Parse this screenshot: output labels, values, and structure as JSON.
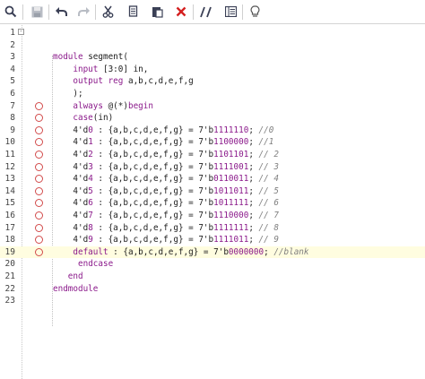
{
  "toolbar": {
    "buttons": [
      {
        "name": "search-icon",
        "glyph": "search"
      },
      {
        "name": "save-icon",
        "glyph": "save"
      },
      {
        "name": "undo-icon",
        "glyph": "undo"
      },
      {
        "name": "redo-icon",
        "glyph": "redo"
      },
      {
        "name": "cut-icon",
        "glyph": "cut"
      },
      {
        "name": "copy-icon",
        "glyph": "copy"
      },
      {
        "name": "paste-icon",
        "glyph": "paste"
      },
      {
        "name": "delete-icon",
        "glyph": "delete"
      },
      {
        "name": "comment-icon",
        "glyph": "comment"
      },
      {
        "name": "indent-icon",
        "glyph": "indent"
      },
      {
        "name": "hint-icon",
        "glyph": "hint"
      }
    ],
    "colors": {
      "icon": "#3a3f55",
      "delete": "#d42020",
      "hint": "#555555"
    }
  },
  "editor": {
    "highlighted_line": 19,
    "colors": {
      "keyword": "#8b1a8b",
      "comment": "#808080",
      "highlight": "#fffde0",
      "breakpoint": "#d24b4b"
    },
    "lines": [
      {
        "n": "1",
        "fold": true,
        "bp": false,
        "tokens": []
      },
      {
        "n": "2",
        "bp": false,
        "tokens": []
      },
      {
        "n": "3",
        "bp": false,
        "tokens": [
          [
            "k",
            "module"
          ],
          [
            "t",
            " segment("
          ]
        ]
      },
      {
        "n": "4",
        "bp": false,
        "tokens": [
          [
            "t",
            "    "
          ],
          [
            "k",
            "input"
          ],
          [
            "t",
            " [3:0] in,"
          ]
        ]
      },
      {
        "n": "5",
        "bp": false,
        "tokens": [
          [
            "t",
            "    "
          ],
          [
            "k",
            "output reg"
          ],
          [
            "t",
            " a,b,c,d,e,f,g"
          ]
        ]
      },
      {
        "n": "6",
        "bp": false,
        "tokens": [
          [
            "t",
            "    );"
          ]
        ]
      },
      {
        "n": "7",
        "bp": true,
        "tokens": [
          [
            "t",
            "    "
          ],
          [
            "k",
            "always"
          ],
          [
            "t",
            " @(*)"
          ],
          [
            "k",
            "begin"
          ]
        ]
      },
      {
        "n": "8",
        "bp": true,
        "tokens": [
          [
            "t",
            "    "
          ],
          [
            "k",
            "case"
          ],
          [
            "t",
            "(in)"
          ]
        ]
      },
      {
        "n": "9",
        "bp": true,
        "tokens": [
          [
            "t",
            "    4'd"
          ],
          [
            "n",
            "0"
          ],
          [
            "t",
            " : {a,b,c,d,e,f,g} = 7'b"
          ],
          [
            "n",
            "1111110"
          ],
          [
            "t",
            "; "
          ],
          [
            "c",
            "//0"
          ]
        ]
      },
      {
        "n": "10",
        "bp": true,
        "tokens": [
          [
            "t",
            "    4'd"
          ],
          [
            "n",
            "1"
          ],
          [
            "t",
            " : {a,b,c,d,e,f,g} = 7'b"
          ],
          [
            "n",
            "1100000"
          ],
          [
            "t",
            "; "
          ],
          [
            "c",
            "//1"
          ]
        ]
      },
      {
        "n": "11",
        "bp": true,
        "tokens": [
          [
            "t",
            "    4'd"
          ],
          [
            "n",
            "2"
          ],
          [
            "t",
            " : {a,b,c,d,e,f,g} = 7'b"
          ],
          [
            "n",
            "1101101"
          ],
          [
            "t",
            "; "
          ],
          [
            "c",
            "// 2"
          ]
        ]
      },
      {
        "n": "12",
        "bp": true,
        "tokens": [
          [
            "t",
            "    4'd"
          ],
          [
            "n",
            "3"
          ],
          [
            "t",
            " : {a,b,c,d,e,f,g} = 7'b"
          ],
          [
            "n",
            "1111001"
          ],
          [
            "t",
            "; "
          ],
          [
            "c",
            "// 3"
          ]
        ]
      },
      {
        "n": "13",
        "bp": true,
        "tokens": [
          [
            "t",
            "    4'd"
          ],
          [
            "n",
            "4"
          ],
          [
            "t",
            " : {a,b,c,d,e,f,g} = 7'b"
          ],
          [
            "n",
            "0110011"
          ],
          [
            "t",
            "; "
          ],
          [
            "c",
            "// 4"
          ]
        ]
      },
      {
        "n": "14",
        "bp": true,
        "tokens": [
          [
            "t",
            "    4'd"
          ],
          [
            "n",
            "5"
          ],
          [
            "t",
            " : {a,b,c,d,e,f,g} = 7'b"
          ],
          [
            "n",
            "1011011"
          ],
          [
            "t",
            "; "
          ],
          [
            "c",
            "// 5"
          ]
        ]
      },
      {
        "n": "15",
        "bp": true,
        "tokens": [
          [
            "t",
            "    4'd"
          ],
          [
            "n",
            "6"
          ],
          [
            "t",
            " : {a,b,c,d,e,f,g} = 7'b"
          ],
          [
            "n",
            "1011111"
          ],
          [
            "t",
            "; "
          ],
          [
            "c",
            "// 6"
          ]
        ]
      },
      {
        "n": "16",
        "bp": true,
        "tokens": [
          [
            "t",
            "    4'd"
          ],
          [
            "n",
            "7"
          ],
          [
            "t",
            " : {a,b,c,d,e,f,g} = 7'b"
          ],
          [
            "n",
            "1110000"
          ],
          [
            "t",
            "; "
          ],
          [
            "c",
            "// 7"
          ]
        ]
      },
      {
        "n": "17",
        "bp": true,
        "tokens": [
          [
            "t",
            "    4'd"
          ],
          [
            "n",
            "8"
          ],
          [
            "t",
            " : {a,b,c,d,e,f,g} = 7'b"
          ],
          [
            "n",
            "1111111"
          ],
          [
            "t",
            "; "
          ],
          [
            "c",
            "// 8"
          ]
        ]
      },
      {
        "n": "18",
        "bp": true,
        "tokens": [
          [
            "t",
            "    4'd"
          ],
          [
            "n",
            "9"
          ],
          [
            "t",
            " : {a,b,c,d,e,f,g} = 7'b"
          ],
          [
            "n",
            "1111011"
          ],
          [
            "t",
            "; "
          ],
          [
            "c",
            "// 9"
          ]
        ]
      },
      {
        "n": "19",
        "bp": true,
        "tokens": [
          [
            "t",
            "    "
          ],
          [
            "k",
            "default"
          ],
          [
            "t",
            " : {a,b,c,d,e,f,g} = 7'b"
          ],
          [
            "n",
            "0000000"
          ],
          [
            "t",
            "; "
          ],
          [
            "c",
            "//blank"
          ]
        ]
      },
      {
        "n": "20",
        "bp": false,
        "tokens": [
          [
            "t",
            "     "
          ],
          [
            "k",
            "endcase"
          ]
        ]
      },
      {
        "n": "21",
        "bp": false,
        "tokens": [
          [
            "t",
            "   "
          ],
          [
            "k",
            "end"
          ]
        ]
      },
      {
        "n": "22",
        "bp": false,
        "tokens": [
          [
            "k",
            "endmodule"
          ]
        ]
      },
      {
        "n": "23",
        "bp": false,
        "tokens": []
      }
    ]
  }
}
